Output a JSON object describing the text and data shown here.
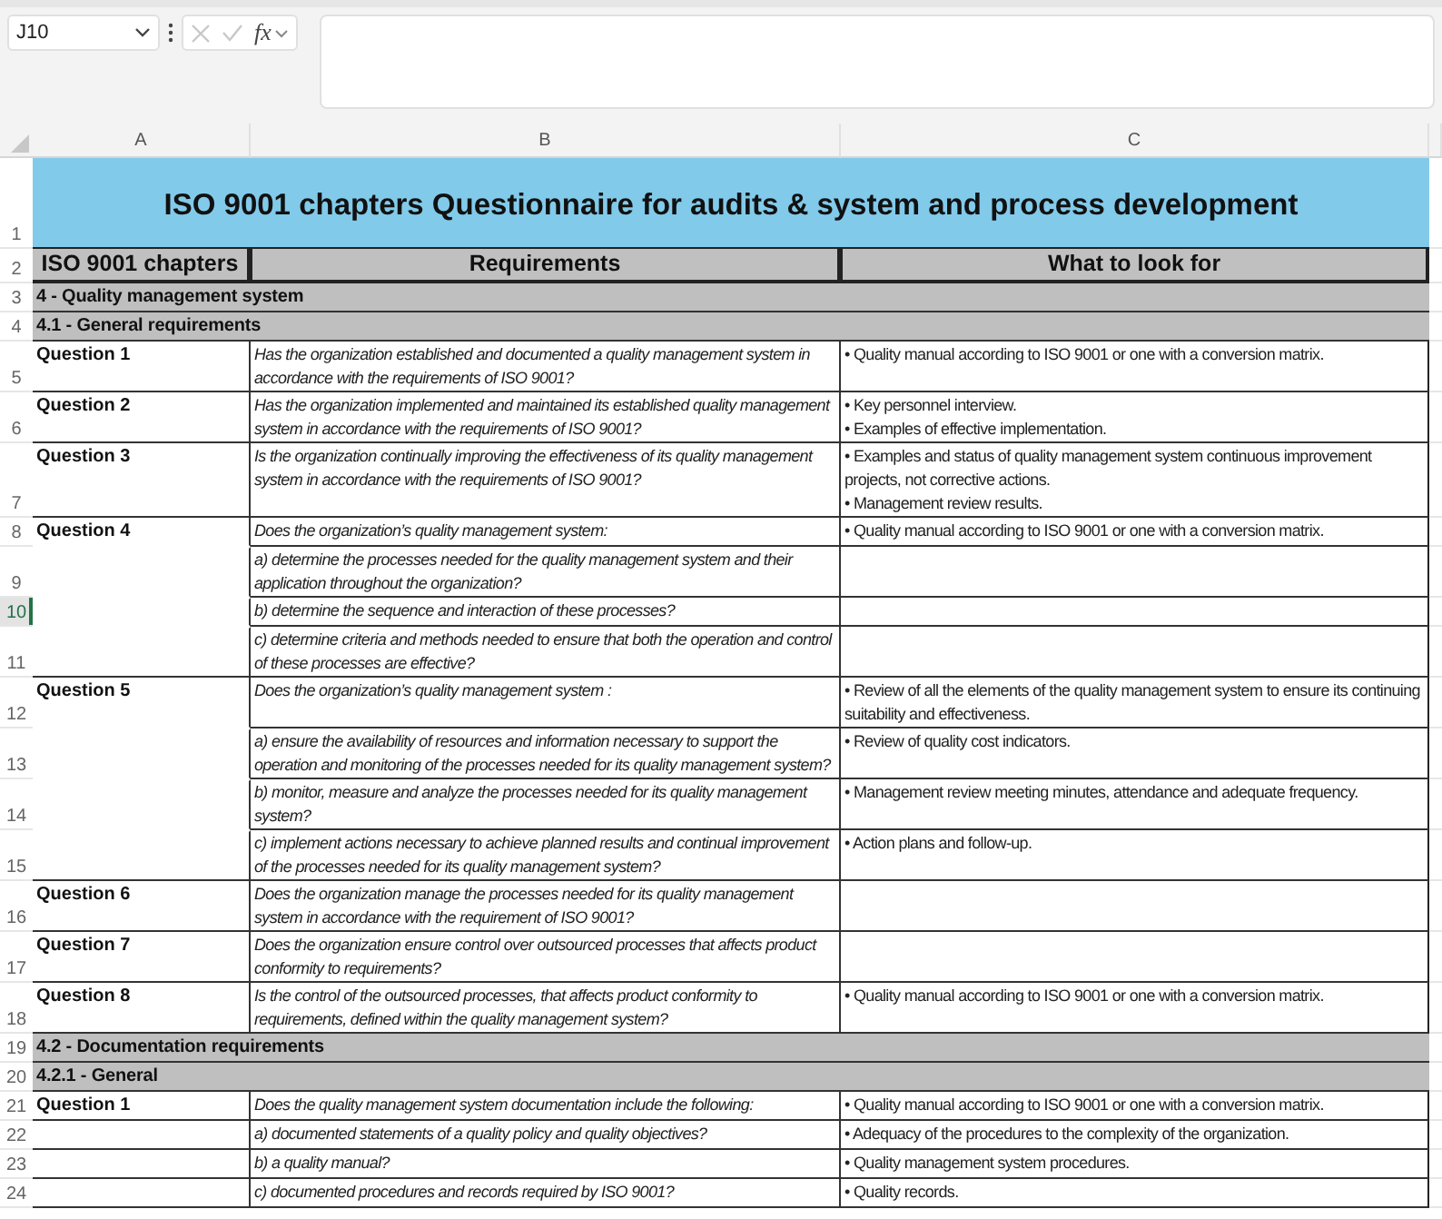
{
  "formula_bar": {
    "name_box": "J10",
    "function_label": "fx"
  },
  "columns": [
    {
      "label": "A",
      "selected": false
    },
    {
      "label": "B",
      "selected": false
    },
    {
      "label": "C",
      "selected": false
    }
  ],
  "rows": [
    {
      "num": "1",
      "selected": false,
      "kind": "title",
      "text": "ISO 9001 chapters Questionnaire for audits & system and process development"
    },
    {
      "num": "2",
      "selected": false,
      "kind": "header",
      "cells": [
        "ISO 9001 chapters",
        "Requirements",
        "What to look for"
      ]
    },
    {
      "num": "3",
      "selected": false,
      "kind": "section",
      "text": "4 - Quality management system"
    },
    {
      "num": "4",
      "selected": false,
      "kind": "section",
      "text": "4.1 - General requirements"
    },
    {
      "num": "5",
      "selected": false,
      "kind": "question",
      "continued": false,
      "a": "Question 1",
      "b": "Has the organization established and documented a quality management system in accordance with the requirements of ISO 9001?",
      "c": [
        "• Quality manual according to ISO 9001 or one with a conversion matrix."
      ]
    },
    {
      "num": "6",
      "selected": false,
      "kind": "question",
      "continued": false,
      "a": "Question 2",
      "b": "Has the organization implemented and maintained its established quality management system in accordance with the requirements of ISO 9001?",
      "c": [
        "• Key personnel interview.",
        "• Examples of effective implementation."
      ]
    },
    {
      "num": "7",
      "selected": false,
      "kind": "question",
      "continued": false,
      "a": "Question 3",
      "b": "Is the organization continually improving the effectiveness of its quality management system in accordance with the requirements of ISO 9001?",
      "c": [
        "• Examples and status of quality management system continuous improvement projects, not corrective actions.",
        "• Management review results."
      ]
    },
    {
      "num": "8",
      "selected": false,
      "kind": "question",
      "continued": false,
      "a": "Question 4",
      "b": "Does the organization’s quality management system:",
      "c": [
        "• Quality manual according to ISO 9001 or one with a conversion matrix."
      ]
    },
    {
      "num": "9",
      "selected": false,
      "kind": "question",
      "continued": true,
      "b": "a) determine the processes needed for the quality management system and their application throughout the organization?"
    },
    {
      "num": "10",
      "selected": true,
      "kind": "question",
      "continued": true,
      "b": "b) determine the sequence and interaction of these processes?"
    },
    {
      "num": "11",
      "selected": false,
      "kind": "question",
      "continued": true,
      "b": "c) determine criteria and methods needed to ensure that both the operation and control of these processes are effective?"
    },
    {
      "num": "12",
      "selected": false,
      "kind": "question",
      "continued": false,
      "a": "Question 5",
      "b": "Does the organization’s quality management system :",
      "c": [
        "• Review of all the elements of the quality management system to ensure its continuing suitability and effectiveness."
      ]
    },
    {
      "num": "13",
      "selected": false,
      "kind": "question",
      "continued": true,
      "b": "a) ensure the availability of resources and information necessary to support the operation and monitoring of the processes needed for its quality management system?",
      "c": [
        "• Review of  quality cost indicators."
      ]
    },
    {
      "num": "14",
      "selected": false,
      "kind": "question",
      "continued": true,
      "b": "b) monitor, measure and analyze the processes needed for its quality management system?",
      "c": [
        "• Management review meeting minutes, attendance and adequate frequency."
      ]
    },
    {
      "num": "15",
      "selected": false,
      "kind": "question",
      "continued": true,
      "b": "c) implement actions necessary to achieve planned results and continual improvement of the processes needed for its quality management system?",
      "c": [
        "• Action plans and follow-up."
      ]
    },
    {
      "num": "16",
      "selected": false,
      "kind": "question",
      "continued": false,
      "a": "Question 6",
      "b": "Does the organization manage the processes needed for its quality management system in accordance with the requirement of ISO 9001?"
    },
    {
      "num": "17",
      "selected": false,
      "kind": "question",
      "continued": false,
      "a": "Question 7",
      "b": "Does the organization ensure control over outsourced processes that affects product conformity to requirements?"
    },
    {
      "num": "18",
      "selected": false,
      "kind": "question",
      "continued": false,
      "a": "Question 8",
      "b": "Is the control of the outsourced processes, that affects product conformity to requirements, defined within the quality management system?",
      "c": [
        "• Quality manual according to ISO 9001 or one with a conversion matrix."
      ]
    },
    {
      "num": "19",
      "selected": false,
      "kind": "section",
      "text": "4.2 - Documentation requirements"
    },
    {
      "num": "20",
      "selected": false,
      "kind": "section",
      "text": "4.2.1 - General"
    },
    {
      "num": "21",
      "selected": false,
      "kind": "question",
      "continued": false,
      "a": "Question 1",
      "b": "Does the quality management system documentation include the following:",
      "c": [
        "• Quality manual according to ISO 9001 or one with a conversion matrix."
      ]
    },
    {
      "num": "22",
      "selected": false,
      "kind": "question",
      "continued": false,
      "b": "a) documented statements of a quality policy and quality objectives?",
      "c": [
        "• Adequacy of the procedures to the complexity of the organization."
      ]
    },
    {
      "num": "23",
      "selected": false,
      "kind": "question",
      "continued": false,
      "b": "b) a quality manual?",
      "c": [
        "• Quality management system procedures."
      ]
    },
    {
      "num": "24",
      "selected": false,
      "kind": "question",
      "continued": false,
      "b": "c) documented procedures and records required by ISO 9001?",
      "c": [
        "• Quality records."
      ]
    }
  ]
}
